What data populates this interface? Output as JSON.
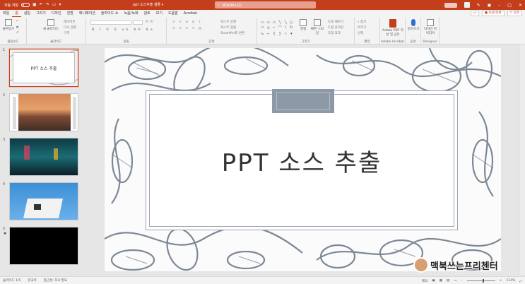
{
  "titlebar": {
    "autosave": "자동 저장",
    "doc_title": "ppt 소스추출 샘플 ▾",
    "search_placeholder": "검색(Alt+Q)",
    "window_controls": [
      "–",
      "□",
      "✕"
    ]
  },
  "menu": {
    "tabs": [
      "파일",
      "홈",
      "삽입",
      "그리기",
      "디자인",
      "전환",
      "애니메이션",
      "슬라이드 쇼",
      "녹음/녹화",
      "검토",
      "보기",
      "도움말",
      "Acrobat"
    ],
    "active": "홈",
    "record_button": "● 녹음/녹화",
    "share_button": "⇧ 공유"
  },
  "ribbon": {
    "clipboard": {
      "paste": "붙여넣기",
      "label": "클립보드"
    },
    "slides": {
      "new_slide": "새 슬라이드",
      "layout": "레이아웃",
      "reset": "다시 설정",
      "section": "구역",
      "label": "슬라이드"
    },
    "font": {
      "label": "글꼴"
    },
    "paragraph": {
      "text_direction": "텍스트 방향",
      "align_text": "텍스트 맞춤",
      "smartart": "SmartArt로 변환",
      "label": "단락"
    },
    "drawing": {
      "arrange": "정렬",
      "quick_styles": "빠른 스타일",
      "shape_fill": "도형 채우기",
      "shape_outline": "도형 윤곽선",
      "shape_effects": "도형 효과",
      "label": "그리기"
    },
    "editing": {
      "find": "찾기",
      "replace": "바꾸기",
      "select": "선택",
      "label": "편집"
    },
    "acrobat": {
      "button": "Adobe PDF 작성 및 공유",
      "label": "Adobe Acrobat"
    },
    "voice": {
      "dictate": "받아쓰기",
      "label": "음성"
    },
    "designer": {
      "ideas": "디자인 아이디어",
      "label": "Designer"
    }
  },
  "thumbnails": [
    {
      "num": "1",
      "title": "PPT 소스 추출",
      "selected": true
    },
    {
      "num": "2",
      "title": "",
      "selected": false
    },
    {
      "num": "3",
      "title": "",
      "selected": false
    },
    {
      "num": "4",
      "title": "",
      "selected": false
    },
    {
      "num": "5",
      "title": "",
      "selected": false
    }
  ],
  "slide": {
    "title": "PPT 소스 추출"
  },
  "statusbar": {
    "slide_info": "슬라이드 1/5",
    "language": "한국어",
    "accessibility": "접근성: 조사 필요",
    "notes": "메모",
    "zoom": "114%"
  },
  "watermark": {
    "text": "맥북쓰는프리첸터"
  },
  "colors": {
    "accent": "#c43e1c",
    "pattern": "#7d8896",
    "tab_fill": "#8c99a6"
  },
  "icons": [
    "search-icon",
    "save-icon",
    "undo-icon",
    "redo-icon",
    "paste-icon",
    "new-slide-icon",
    "find-icon",
    "mic-icon",
    "designer-icon",
    "settings-icon"
  ]
}
